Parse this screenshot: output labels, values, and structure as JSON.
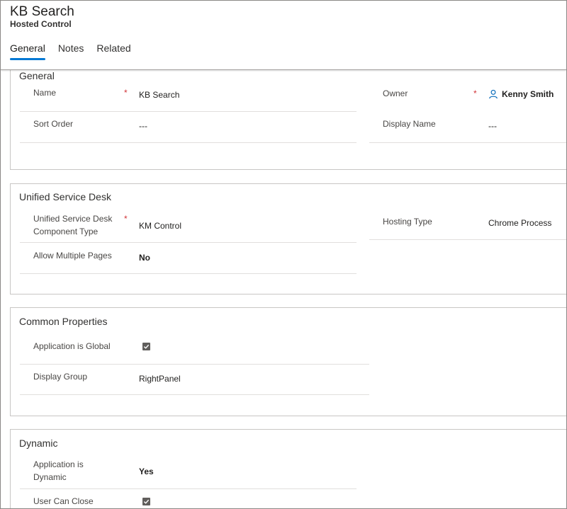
{
  "header": {
    "title": "KB Search",
    "subtitle": "Hosted Control",
    "tabs": [
      {
        "label": "General"
      },
      {
        "label": "Notes"
      },
      {
        "label": "Related"
      }
    ]
  },
  "sections": {
    "general": {
      "title": "General",
      "name_label": "Name",
      "name_value": "KB Search",
      "sort_label": "Sort Order",
      "sort_value": "---",
      "owner_label": "Owner",
      "owner_value": "Kenny Smith",
      "display_name_label": "Display Name",
      "display_name_value": "---"
    },
    "usd": {
      "title": "Unified Service Desk",
      "component_label_line1": "Unified Service Desk",
      "component_label_line2": "Component Type",
      "component_value": "KM Control",
      "allow_label": "Allow Multiple Pages",
      "allow_value": "No",
      "hosting_label": "Hosting Type",
      "hosting_value": "Chrome Process"
    },
    "common": {
      "title": "Common Properties",
      "global_label": "Application is Global",
      "global_checked": true,
      "display_group_label": "Display Group",
      "display_group_value": "RightPanel"
    },
    "dynamic": {
      "title": "Dynamic",
      "dynamic_label_line1": "Application is",
      "dynamic_label_line2": "Dynamic",
      "dynamic_value": "Yes",
      "close_label": "User Can Close",
      "close_checked": true
    }
  },
  "required_marker": "*",
  "colors": {
    "accent": "#0078d4",
    "link": "#0067b8",
    "required": "#d13438"
  },
  "icons": {
    "owner": "person-icon",
    "checkbox": "checkmark-icon"
  }
}
